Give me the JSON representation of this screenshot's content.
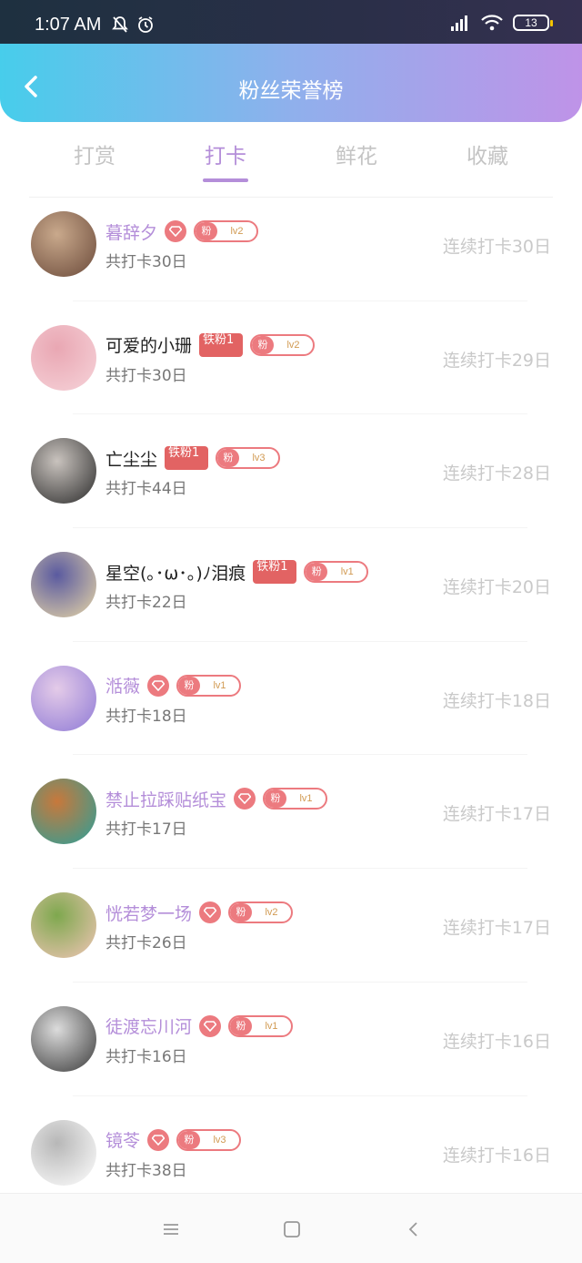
{
  "status": {
    "time": "1:07 AM",
    "battery": "13"
  },
  "header": {
    "title": "粉丝荣誉榜"
  },
  "tabs": [
    {
      "label": "打赏",
      "active": false
    },
    {
      "label": "打卡",
      "active": true
    },
    {
      "label": "鲜花",
      "active": false
    },
    {
      "label": "收藏",
      "active": false
    }
  ],
  "colors": {
    "accent": "#b48ed9",
    "badge": "#ec7a7f",
    "iron": "#e26363"
  },
  "rows": [
    {
      "name": "暮辞夕",
      "name_color": "purple",
      "heart": true,
      "iron": "",
      "fan": "粉",
      "level": "lv2",
      "total": "共打卡30日",
      "streak": "连续打卡30日",
      "avatar": [
        "#6b4a3a",
        "#c9a98c"
      ]
    },
    {
      "name": "可爱的小珊",
      "name_color": "black",
      "heart": false,
      "iron": "铁粉1",
      "fan": "粉",
      "level": "lv2",
      "total": "共打卡30日",
      "streak": "连续打卡29日",
      "avatar": [
        "#f6d3d9",
        "#e9a7b3"
      ]
    },
    {
      "name": "亡尘尘",
      "name_color": "black",
      "heart": false,
      "iron": "铁粉1",
      "fan": "粉",
      "level": "lv3",
      "total": "共打卡44日",
      "streak": "连续打卡28日",
      "avatar": [
        "#2b2b2b",
        "#c9c3be"
      ]
    },
    {
      "name": "星空(｡･ω･｡)ﾉ泪痕",
      "name_color": "black",
      "heart": false,
      "iron": "铁粉1",
      "fan": "粉",
      "level": "lv1",
      "total": "共打卡22日",
      "streak": "连续打卡20日",
      "avatar": [
        "#e7d6a6",
        "#5a5aa0"
      ]
    },
    {
      "name": "湉薇",
      "name_color": "purple",
      "heart": true,
      "iron": "",
      "fan": "粉",
      "level": "lv1",
      "total": "共打卡18日",
      "streak": "连续打卡18日",
      "avatar": [
        "#8f7ad6",
        "#e4cbe8"
      ]
    },
    {
      "name": "禁止拉踩贴纸宝",
      "name_color": "purple",
      "heart": true,
      "iron": "",
      "fan": "粉",
      "level": "lv1",
      "total": "共打卡17日",
      "streak": "连续打卡17日",
      "avatar": [
        "#2aa09a",
        "#c8783b"
      ]
    },
    {
      "name": "恍若梦一场",
      "name_color": "purple",
      "heart": true,
      "iron": "",
      "fan": "粉",
      "level": "lv2",
      "total": "共打卡26日",
      "streak": "连续打卡17日",
      "avatar": [
        "#f1c5b6",
        "#7ea84e"
      ]
    },
    {
      "name": "徒渡忘川河",
      "name_color": "purple",
      "heart": true,
      "iron": "",
      "fan": "粉",
      "level": "lv1",
      "total": "共打卡16日",
      "streak": "连续打卡16日",
      "avatar": [
        "#3a3a3a",
        "#dcdcdc"
      ]
    },
    {
      "name": "镜苓",
      "name_color": "purple",
      "heart": true,
      "iron": "",
      "fan": "粉",
      "level": "lv3",
      "total": "共打卡38日",
      "streak": "连续打卡16日",
      "avatar": [
        "#ffffff",
        "#b7b7b7"
      ]
    }
  ]
}
